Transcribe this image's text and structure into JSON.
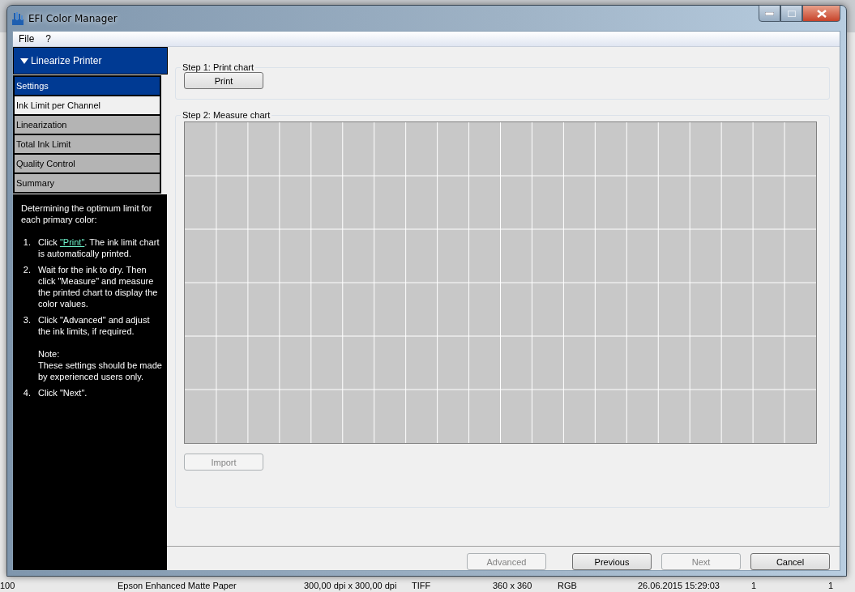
{
  "window": {
    "title": "EFI Color Manager"
  },
  "menu": [
    "File",
    "?"
  ],
  "sidebar": {
    "header": "Linearize Printer",
    "expanded": true,
    "items": [
      {
        "label": "Settings",
        "selected": true,
        "enabled": true
      },
      {
        "label": "Ink Limit per Channel",
        "selected": false,
        "enabled": true
      },
      {
        "label": "Linearization",
        "selected": false,
        "enabled": false
      },
      {
        "label": "Total Ink Limit",
        "selected": false,
        "enabled": false
      },
      {
        "label": "Quality Control",
        "selected": false,
        "enabled": false
      },
      {
        "label": "Summary",
        "selected": false,
        "enabled": false
      }
    ]
  },
  "help": {
    "intro": "Determining the optimum limit for each primary color:",
    "steps": [
      {
        "number": "1.",
        "before": "Click ",
        "link": "\"Print\"",
        "after": ". The ink limit chart is automatically printed."
      },
      {
        "number": "2.",
        "text": "Wait for the ink to dry. Then click \"Measure\" and measure the printed chart to display the color values."
      },
      {
        "number": "3.",
        "text": "Click \"Advanced\" and adjust the ink limits, if required.",
        "note_title": "Note:",
        "note": "These settings should be made by experienced users only."
      },
      {
        "number": "4.",
        "text": "Click \"Next\"."
      }
    ]
  },
  "step1": {
    "title": "Step 1: Print chart",
    "button": {
      "label": "Print",
      "disabled": false
    }
  },
  "step2": {
    "title": "Step 2: Measure chart",
    "button": {
      "label": "Import",
      "disabled": true
    }
  },
  "footer_buttons": [
    {
      "label": "Advanced",
      "disabled": true
    },
    {
      "label": "Previous",
      "disabled": false
    },
    {
      "label": "Next",
      "disabled": true
    },
    {
      "label": "Cancel",
      "disabled": false
    }
  ],
  "background_row": [
    "100",
    "Epson Enhanced Matte Paper",
    "300,00 dpi x 300,00 dpi",
    "TIFF",
    "360 x 360",
    "RGB",
    "26.06.2015 15:29:03",
    "1",
    "1"
  ]
}
